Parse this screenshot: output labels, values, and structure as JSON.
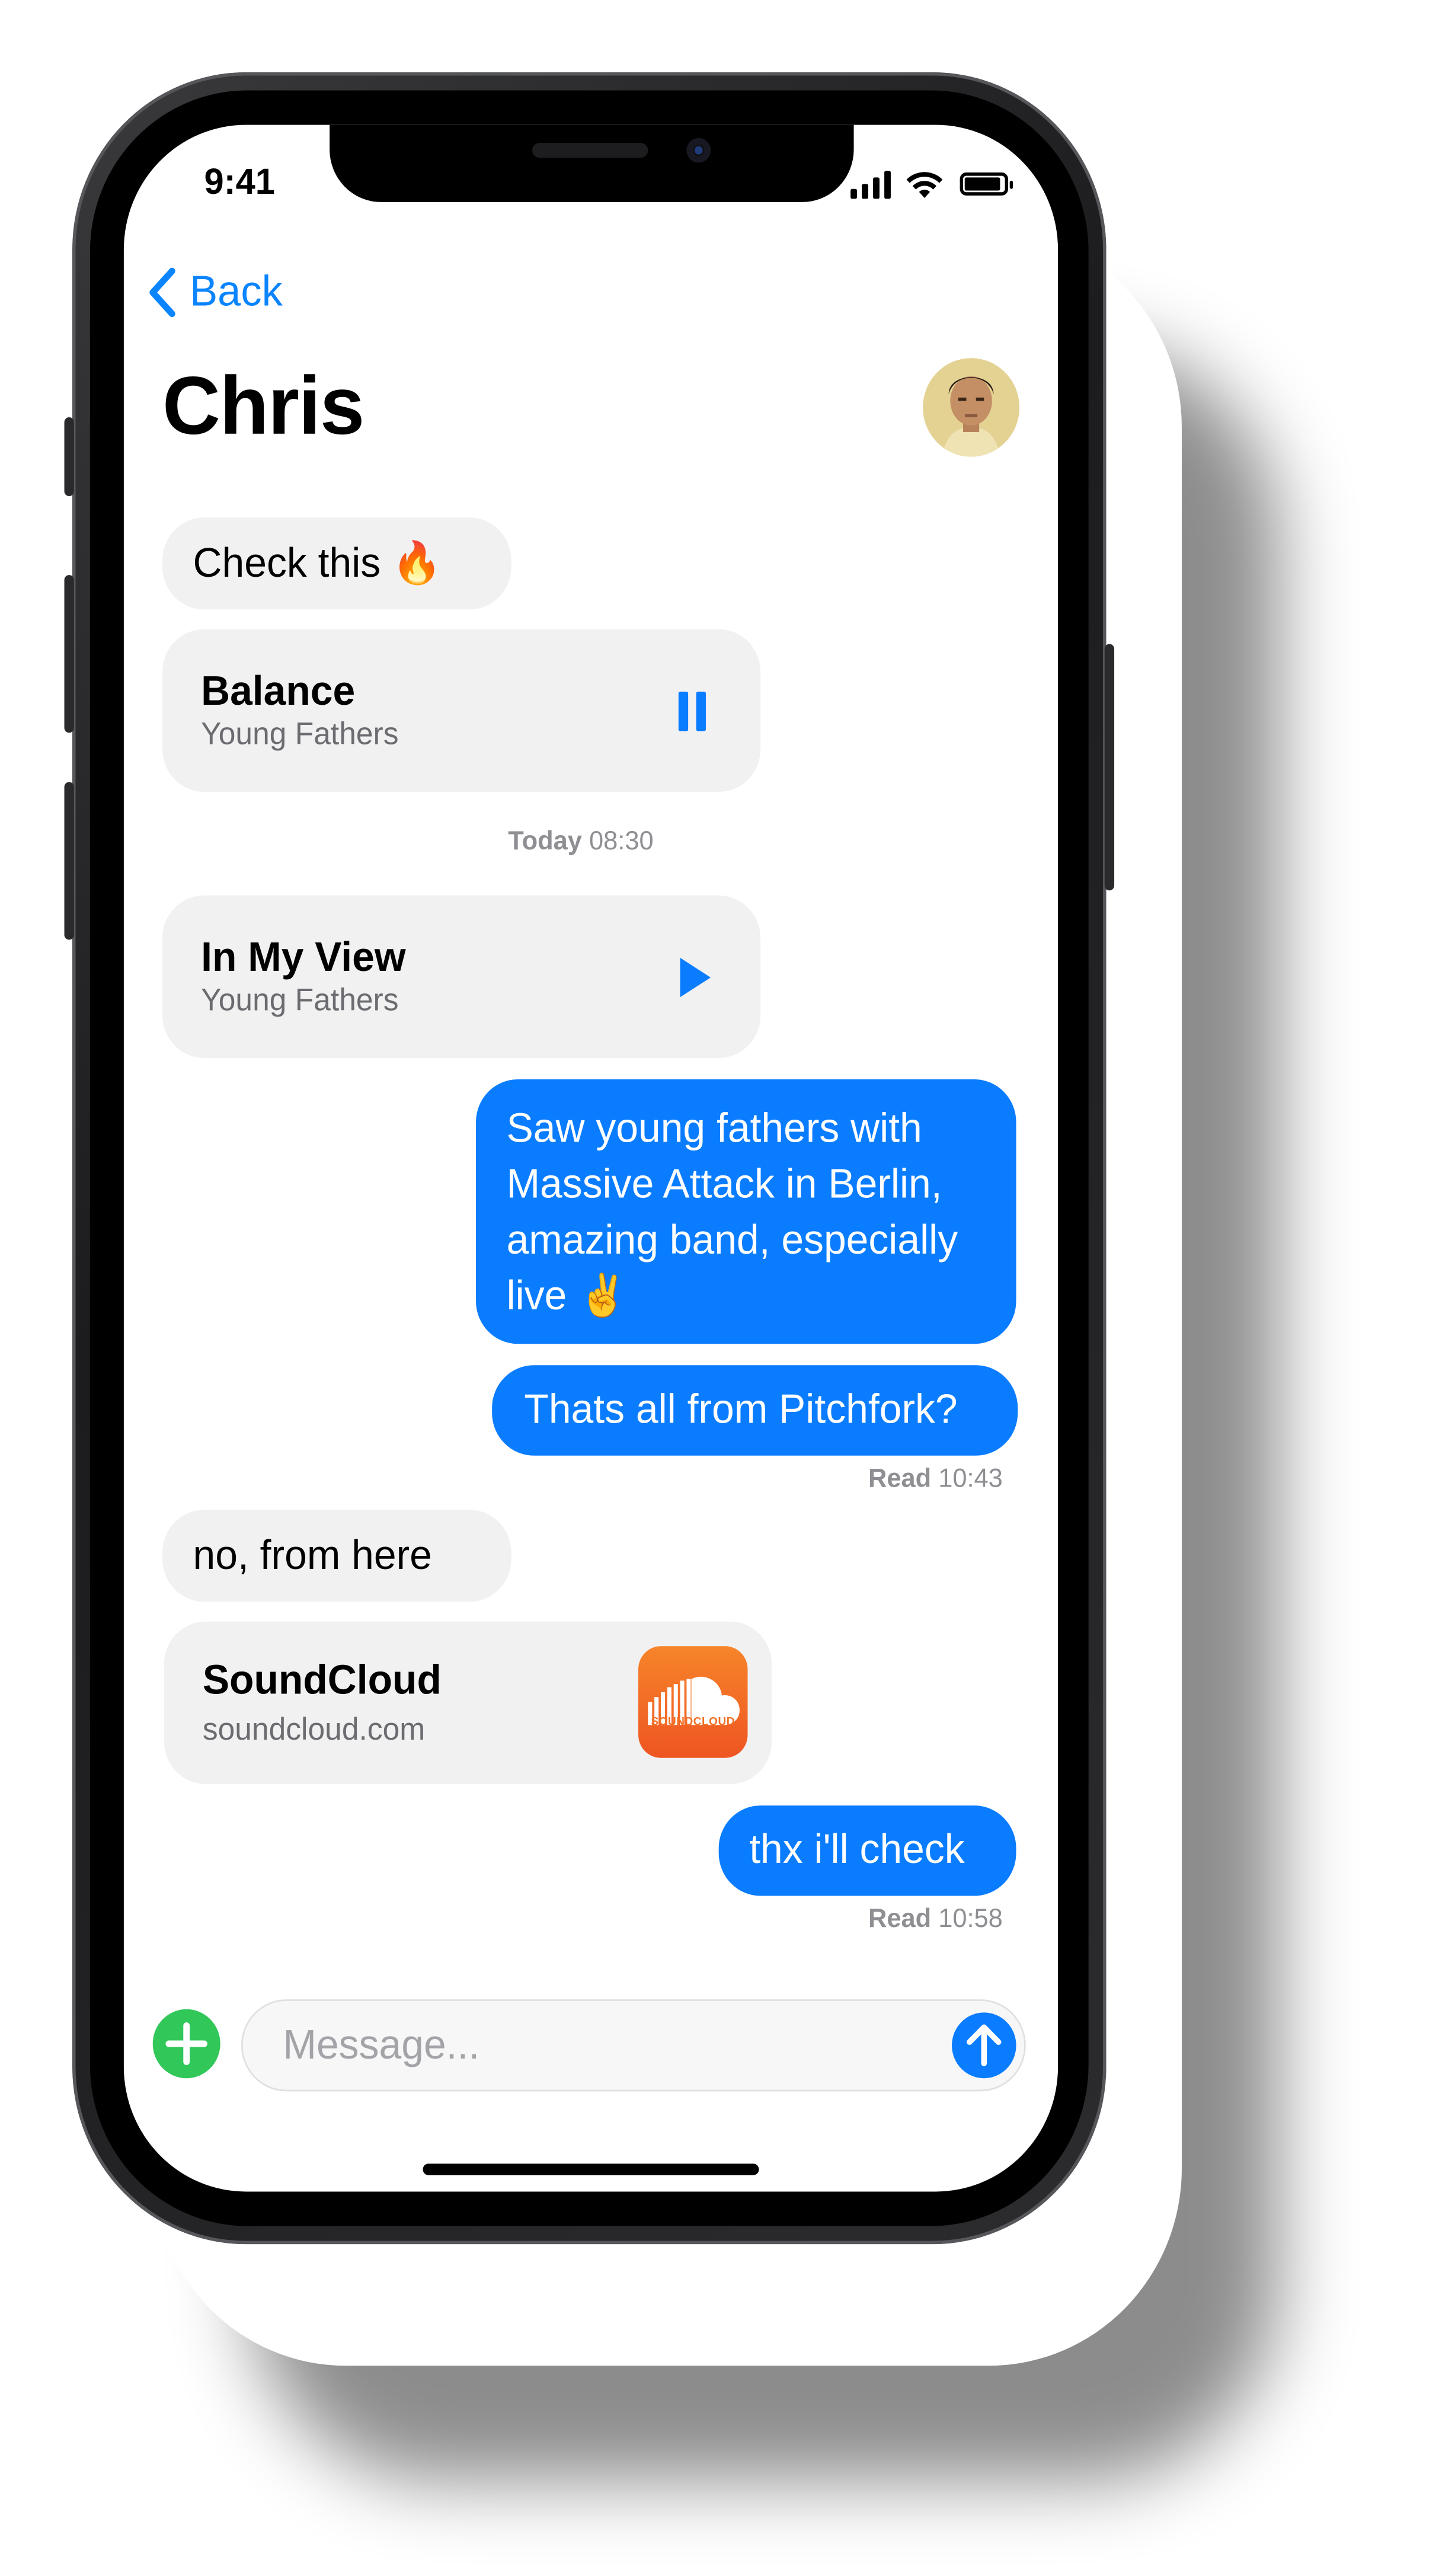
{
  "status_bar": {
    "time": "9:41"
  },
  "nav": {
    "back_label": "Back",
    "contact_name": "Chris"
  },
  "messages": {
    "m1_text": "Check this 🔥",
    "card1": {
      "title": "Balance",
      "subtitle": "Young Fathers",
      "control": "pause-icon"
    },
    "timestamp1": {
      "day": "Today",
      "time": "08:30"
    },
    "card2": {
      "title": "In My View",
      "subtitle": "Young Fathers",
      "control": "play-icon"
    },
    "m2_text": "Saw young fathers with Massive Attack in Berlin, amazing band, especially live ✌️",
    "m3_text": "Thats all from Pitchfork?",
    "read1": {
      "label": "Read",
      "time": "10:43"
    },
    "m4_text": "no, from here",
    "card3": {
      "title": "SoundCloud",
      "subtitle": "soundcloud.com",
      "logo_text": "SOUNDCLOUD"
    },
    "m5_text": "thx i'll check",
    "read2": {
      "label": "Read",
      "time": "10:58"
    }
  },
  "composer": {
    "placeholder": "Message..."
  },
  "colors": {
    "accent_blue": "#0a7cff",
    "incoming_bubble": "#f1f1f2",
    "add_button_green": "#31c759",
    "soundcloud_orange": "#f26f23"
  }
}
